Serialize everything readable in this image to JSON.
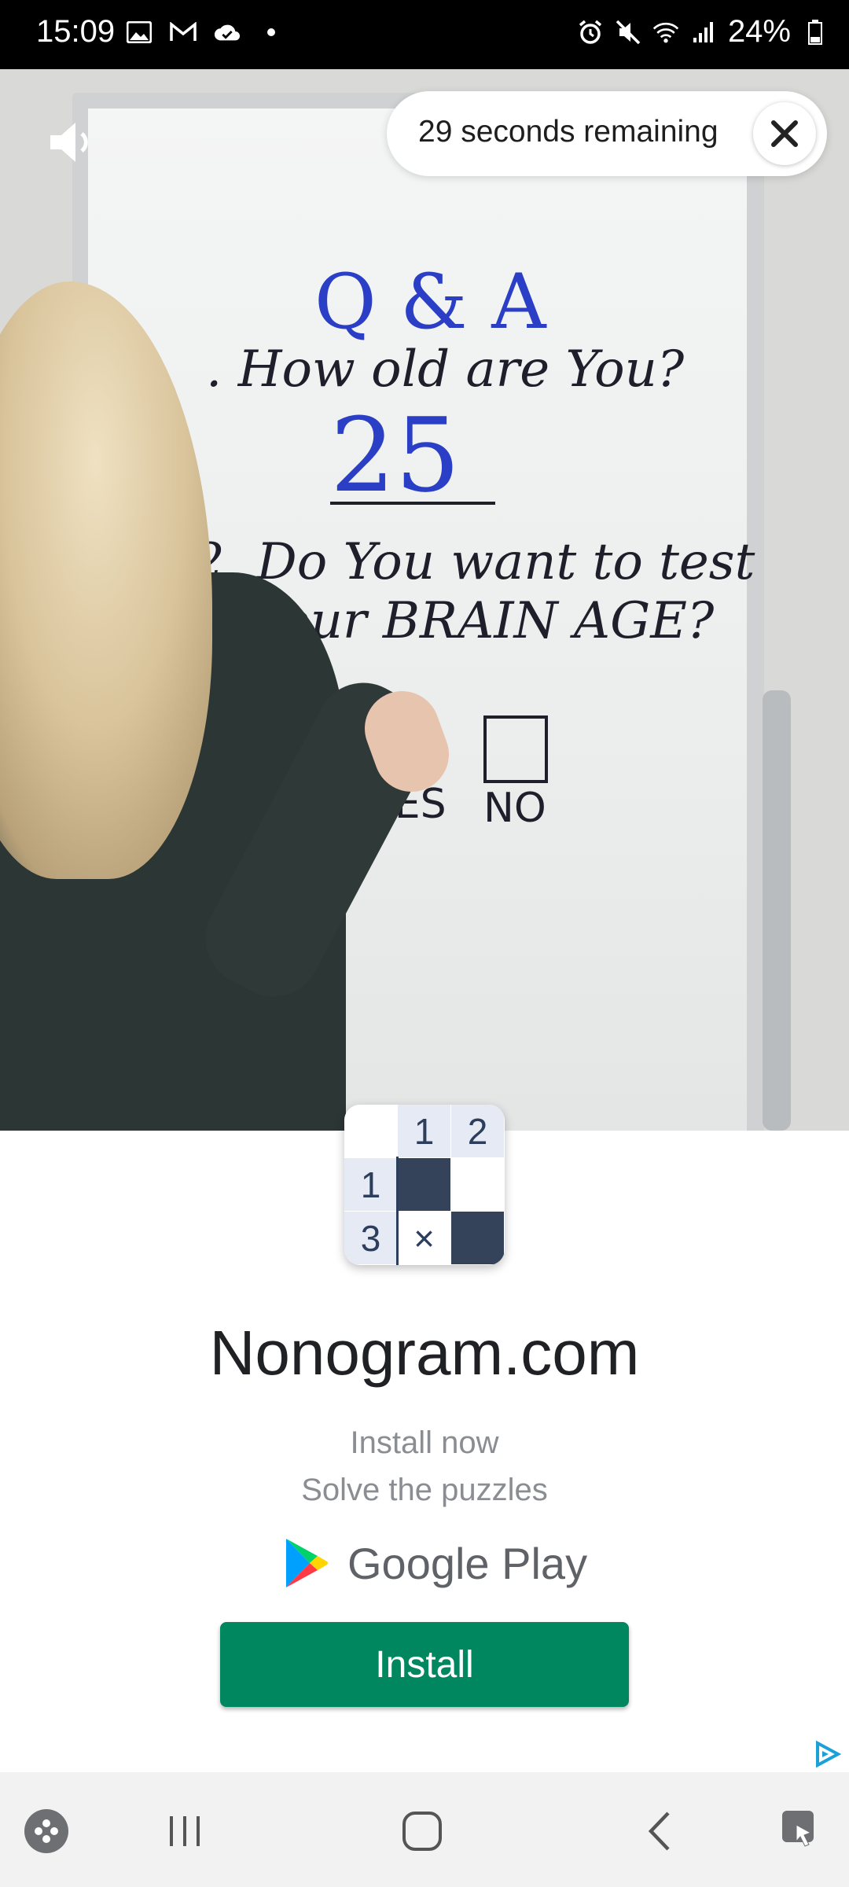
{
  "status_bar": {
    "time": "15:09",
    "left_icons": [
      "gallery-icon",
      "gmail-icon",
      "cloud-icon",
      "dot-icon"
    ],
    "right_icons": [
      "alarm-icon",
      "mute-icon",
      "wifi-icon",
      "signal-icon"
    ],
    "battery": "24%"
  },
  "video": {
    "countdown": "29 seconds remaining",
    "whiteboard": {
      "title": "Q & A",
      "question1": ". How old are You?",
      "answer1": "25",
      "question2_line1": "2. Do You want to test",
      "question2_line2": "your BRAIN AGE?",
      "yes_label": "YES",
      "no_label": "NO"
    }
  },
  "ad": {
    "icon_grid": {
      "col_headers": [
        "1",
        "2"
      ],
      "row_headers": [
        "1",
        "3"
      ],
      "mark": "×"
    },
    "app_name": "Nonogram.com",
    "tagline1": "Install now",
    "tagline2": "Solve the puzzles",
    "store_name": "Google Play",
    "install_label": "Install",
    "colors": {
      "install_button": "#01875f",
      "tile_dark": "#34425a"
    }
  },
  "nav_bar": {
    "items": [
      "game-launcher-icon",
      "recents-icon",
      "home-icon",
      "back-icon",
      "assistant-icon"
    ]
  }
}
